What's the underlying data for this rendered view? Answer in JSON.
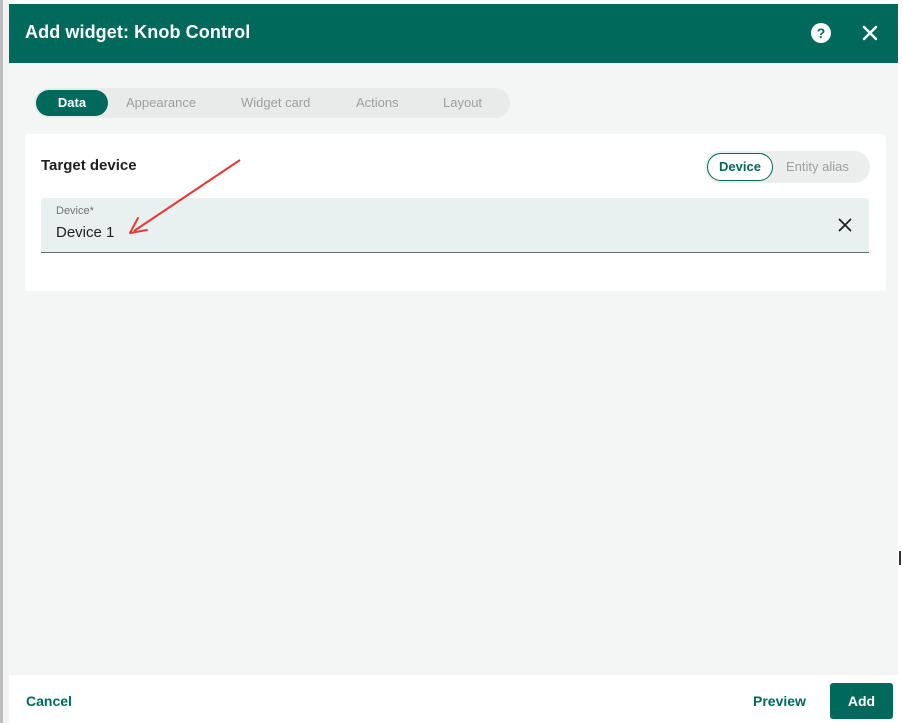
{
  "dialog": {
    "title": "Add widget: Knob Control",
    "help_icon_glyph": "?",
    "close_icon": "close-icon"
  },
  "tabs": [
    {
      "label": "Data",
      "active": true
    },
    {
      "label": "Appearance",
      "active": false
    },
    {
      "label": "Widget card",
      "active": false
    },
    {
      "label": "Actions",
      "active": false
    },
    {
      "label": "Layout",
      "active": false
    }
  ],
  "target": {
    "title": "Target device",
    "toggle": {
      "selected": "Device",
      "other": "Entity alias"
    },
    "field": {
      "label": "Device*",
      "value": "Device 1"
    }
  },
  "footer": {
    "cancel": "Cancel",
    "preview": "Preview",
    "add": "Add"
  },
  "colors": {
    "primary": "#00695c",
    "annotation_arrow": "#e53935"
  }
}
